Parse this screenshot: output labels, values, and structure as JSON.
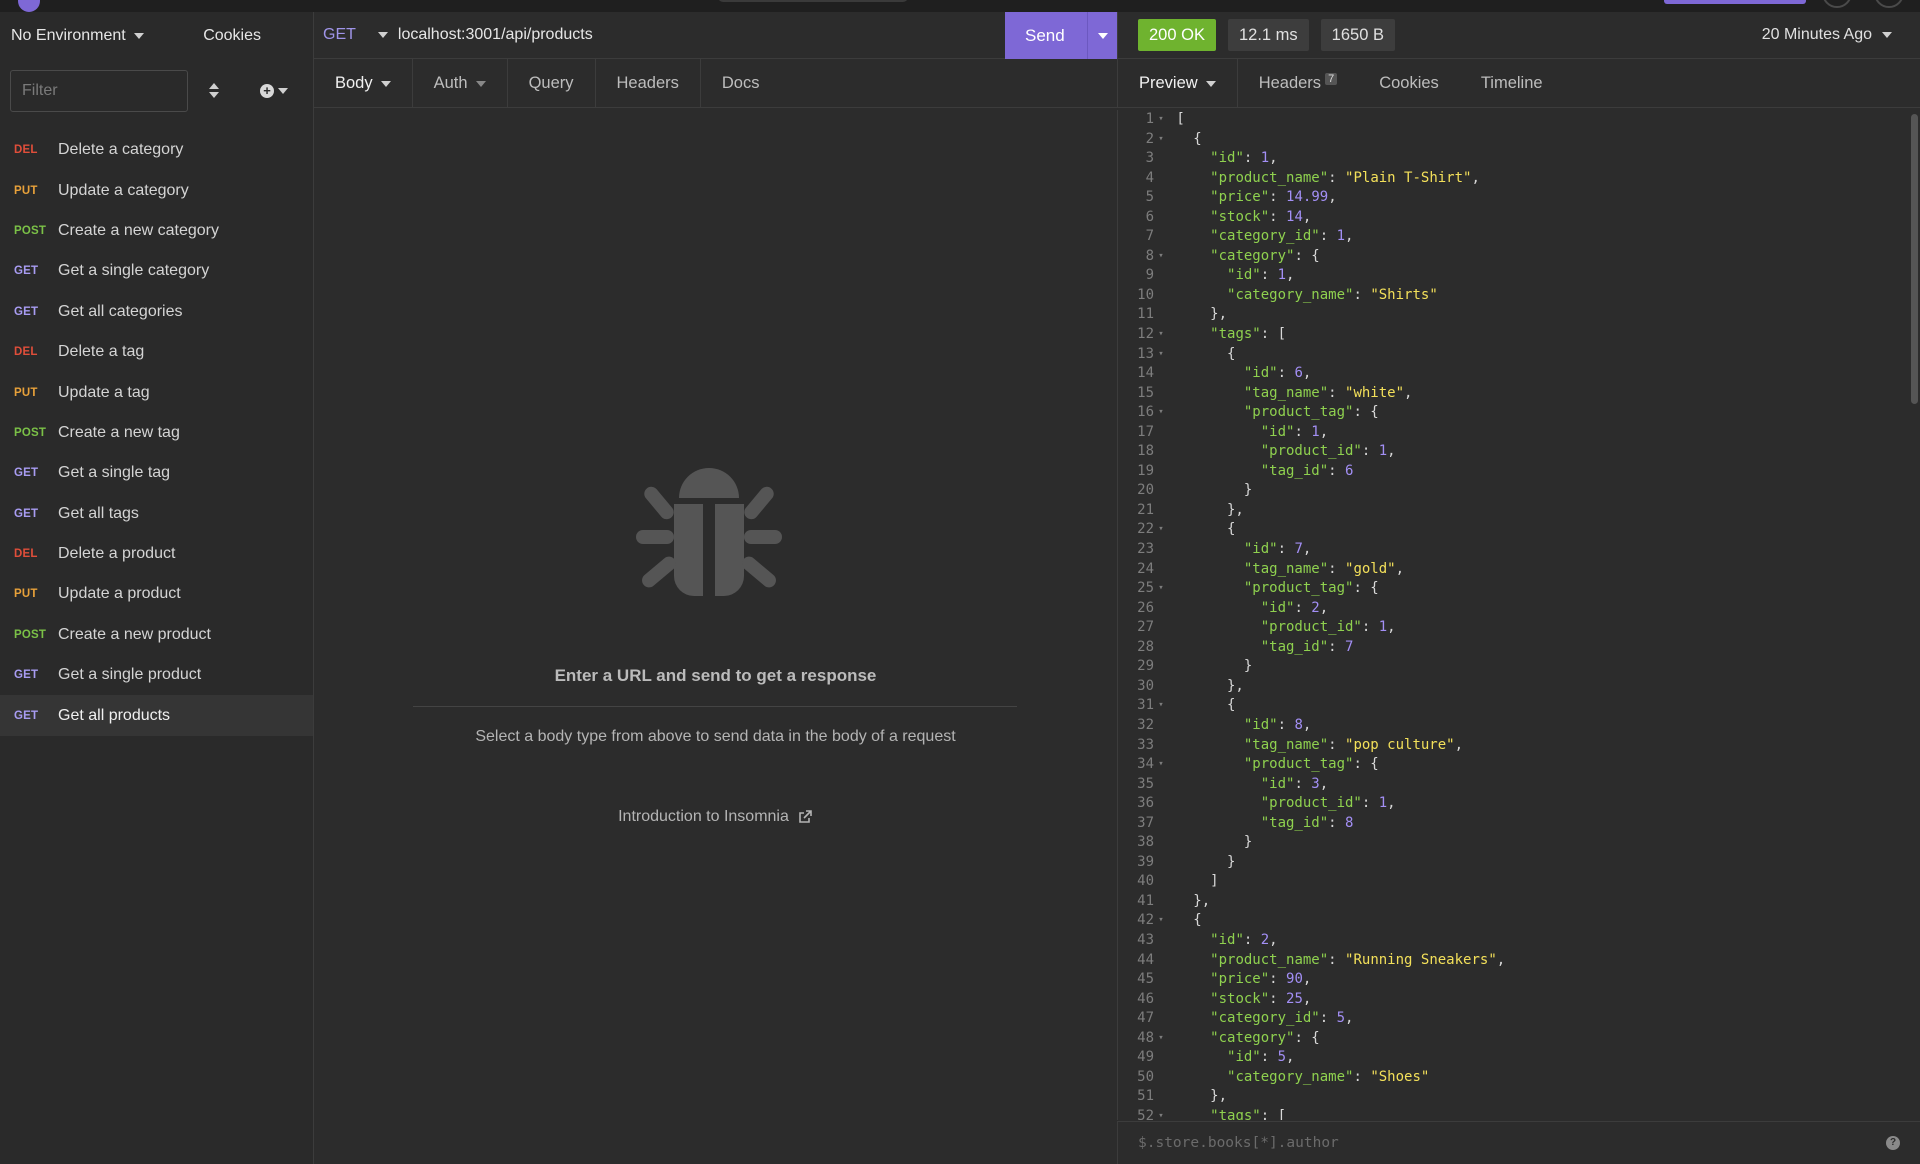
{
  "sidebar": {
    "environment": "No Environment",
    "cookies": "Cookies",
    "filter_placeholder": "Filter",
    "items": [
      {
        "method": "DEL",
        "label": "Delete a category"
      },
      {
        "method": "PUT",
        "label": "Update a category"
      },
      {
        "method": "POST",
        "label": "Create a new category"
      },
      {
        "method": "GET",
        "label": "Get a single category"
      },
      {
        "method": "GET",
        "label": "Get all categories"
      },
      {
        "method": "DEL",
        "label": "Delete a tag"
      },
      {
        "method": "PUT",
        "label": "Update a tag"
      },
      {
        "method": "POST",
        "label": "Create a new tag"
      },
      {
        "method": "GET",
        "label": "Get a single tag"
      },
      {
        "method": "GET",
        "label": "Get all tags"
      },
      {
        "method": "DEL",
        "label": "Delete a product"
      },
      {
        "method": "PUT",
        "label": "Update a product"
      },
      {
        "method": "POST",
        "label": "Create a new product"
      },
      {
        "method": "GET",
        "label": "Get a single product"
      },
      {
        "method": "GET",
        "label": "Get all products"
      }
    ]
  },
  "request": {
    "method": "GET",
    "url": "localhost:3001/api/products",
    "send_label": "Send",
    "tabs": [
      "Body",
      "Auth",
      "Query",
      "Headers",
      "Docs"
    ]
  },
  "empty_state": {
    "title": "Enter a URL and send to get a response",
    "subtitle": "Select a body type from above to send data in the body of a request",
    "link": "Introduction to Insomnia"
  },
  "response": {
    "status": "200 OK",
    "time": "12.1 ms",
    "size": "1650 B",
    "age": "20 Minutes Ago",
    "tabs": [
      "Preview",
      "Headers",
      "Cookies",
      "Timeline"
    ],
    "headers_count": "7",
    "filter_placeholder": "$.store.books[*].author"
  },
  "colors": {
    "accent": "#7e68d6",
    "status_ok": "#6fb32f",
    "del": "#e04e3a",
    "put": "#e8a13a",
    "post": "#7bc147",
    "get": "#a89cf2"
  },
  "code_lines": [
    "[",
    "  {",
    "    \"id\": 1,",
    "    \"product_name\": \"Plain T-Shirt\",",
    "    \"price\": 14.99,",
    "    \"stock\": 14,",
    "    \"category_id\": 1,",
    "    \"category\": {",
    "      \"id\": 1,",
    "      \"category_name\": \"Shirts\"",
    "    },",
    "    \"tags\": [",
    "      {",
    "        \"id\": 6,",
    "        \"tag_name\": \"white\",",
    "        \"product_tag\": {",
    "          \"id\": 1,",
    "          \"product_id\": 1,",
    "          \"tag_id\": 6",
    "        }",
    "      },",
    "      {",
    "        \"id\": 7,",
    "        \"tag_name\": \"gold\",",
    "        \"product_tag\": {",
    "          \"id\": 2,",
    "          \"product_id\": 1,",
    "          \"tag_id\": 7",
    "        }",
    "      },",
    "      {",
    "        \"id\": 8,",
    "        \"tag_name\": \"pop culture\",",
    "        \"product_tag\": {",
    "          \"id\": 3,",
    "          \"product_id\": 1,",
    "          \"tag_id\": 8",
    "        }",
    "      }",
    "    ]",
    "  },",
    "  {",
    "    \"id\": 2,",
    "    \"product_name\": \"Running Sneakers\",",
    "    \"price\": 90,",
    "    \"stock\": 25,",
    "    \"category_id\": 5,",
    "    \"category\": {",
    "      \"id\": 5,",
    "      \"category_name\": \"Shoes\"",
    "    },",
    "    \"tags\": ["
  ]
}
